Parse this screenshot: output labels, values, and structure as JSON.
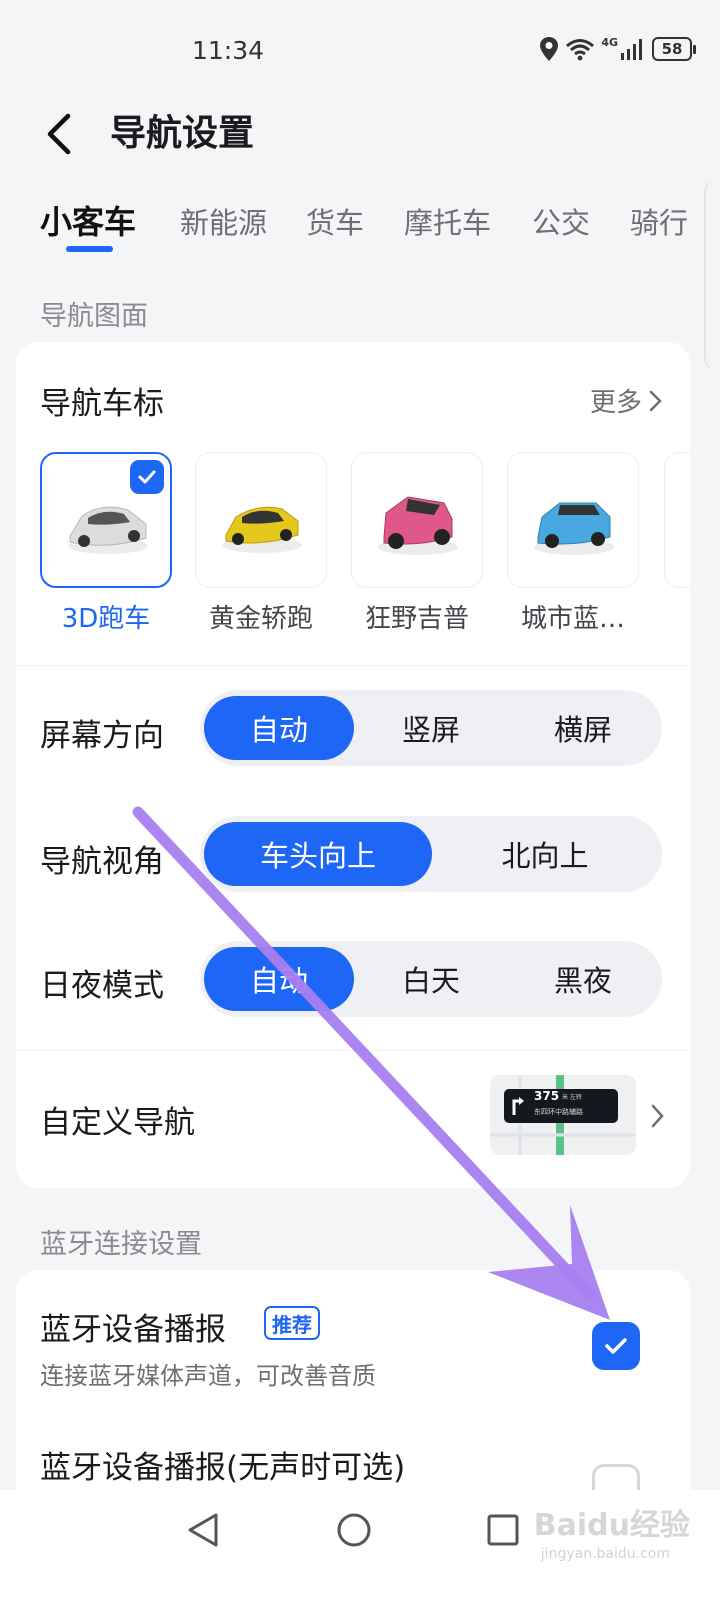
{
  "status_bar": {
    "time": "11:34",
    "network": "4G",
    "battery": "58"
  },
  "header": {
    "title": "导航设置"
  },
  "tabs": [
    {
      "label": "小客车",
      "active": true
    },
    {
      "label": "新能源",
      "active": false
    },
    {
      "label": "货车",
      "active": false
    },
    {
      "label": "摩托车",
      "active": false
    },
    {
      "label": "公交",
      "active": false
    },
    {
      "label": "骑行",
      "active": false
    }
  ],
  "nav_display": {
    "section_label": "导航图面",
    "vehicle_icon": {
      "title": "导航车标",
      "more_label": "更多",
      "options": [
        {
          "label": "3D跑车",
          "selected": true,
          "color": "#d9d9d9"
        },
        {
          "label": "黄金轿跑",
          "selected": false,
          "color": "#e6c71c"
        },
        {
          "label": "狂野吉普",
          "selected": false,
          "color": "#e0578a"
        },
        {
          "label": "城市蓝…",
          "selected": false,
          "color": "#4aa8e0"
        }
      ]
    },
    "screen_orientation": {
      "title": "屏幕方向",
      "options": [
        "自动",
        "竖屏",
        "横屏"
      ],
      "selected": "自动"
    },
    "view_angle": {
      "title": "导航视角",
      "options": [
        "车头向上",
        "北向上"
      ],
      "selected": "车头向上"
    },
    "day_night": {
      "title": "日夜模式",
      "options": [
        "自动",
        "白天",
        "黑夜"
      ],
      "selected": "自动"
    },
    "custom_nav": {
      "title": "自定义导航",
      "preview_distance": "375",
      "preview_unit": "米 左转",
      "preview_road": "东四环中路辅路"
    }
  },
  "bluetooth": {
    "section_label": "蓝牙连接设置",
    "broadcast": {
      "title": "蓝牙设备播报",
      "badge": "推荐",
      "description": "连接蓝牙媒体声道，可改善音质",
      "checked": true
    },
    "broadcast_silent": {
      "title": "蓝牙设备播报(无声时可选)",
      "checked": false
    }
  },
  "watermark": {
    "text": "Baidu经验",
    "sub": "jingyan.baidu.com"
  },
  "colors": {
    "accent": "#1e66f5",
    "annotation_arrow": "#a77ff0"
  }
}
